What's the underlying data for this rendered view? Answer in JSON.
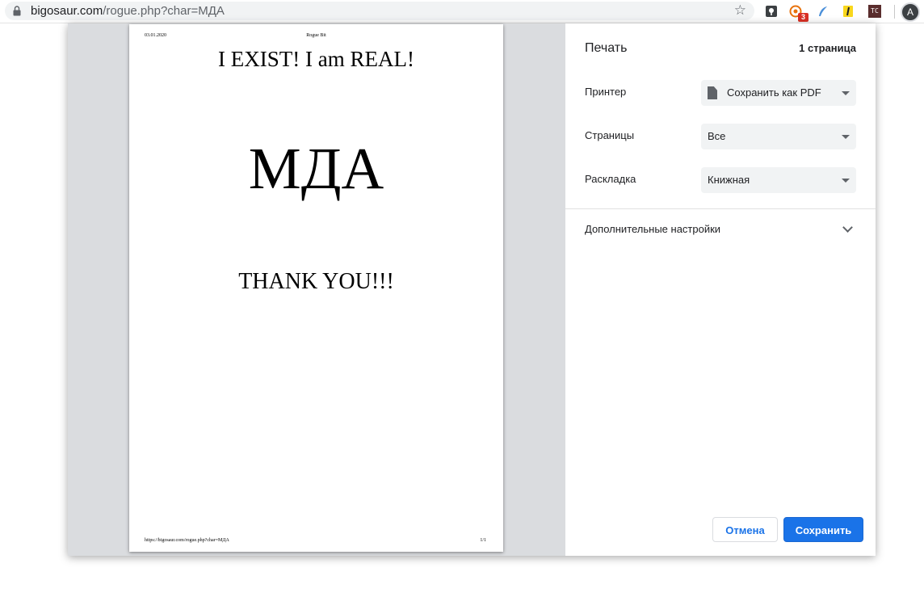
{
  "browser": {
    "url_host": "bigosaur.com",
    "url_path": "/rogue.php?char=МДА",
    "extension_badge": "3",
    "extension_tc_label": "TC",
    "avatar_letter": "A"
  },
  "preview": {
    "header_date": "03.01.2020",
    "header_title": "Rogue Bit",
    "heading": "I EXIST! I am REAL!",
    "big_text": "МДА",
    "thanks": "THANK YOU!!!",
    "footer_url": "https://bigosaur.com/rogue.php?char=МДА",
    "footer_page": "1/1"
  },
  "settings": {
    "title": "Печать",
    "page_count": "1 страница",
    "printer_label": "Принтер",
    "printer_value": "Сохранить как PDF",
    "pages_label": "Страницы",
    "pages_value": "Все",
    "layout_label": "Раскладка",
    "layout_value": "Книжная",
    "more_settings": "Дополнительные настройки",
    "cancel_label": "Отмена",
    "save_label": "Сохранить"
  },
  "colors": {
    "accent": "#1a73e8",
    "preview_bg": "#dadcdf",
    "select_bg": "#f1f3f4"
  }
}
